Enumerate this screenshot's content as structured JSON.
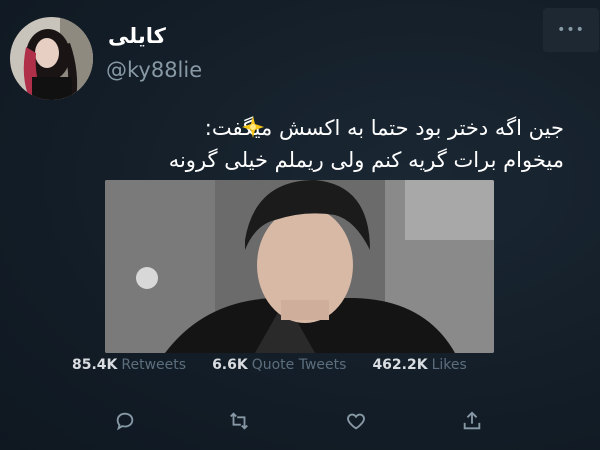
{
  "user": {
    "display_name": "کایلی",
    "handle": "@ky88lie"
  },
  "menu": {
    "more_label": "•••"
  },
  "tweet": {
    "line1": "جین اگه دختر بود حتما به اکسش میگفت:",
    "line2": "میخوام برات گریه کنم ولی ریملم خیلی گرونه",
    "emoji": "sparkle-icon"
  },
  "stats": {
    "retweets_count": "85.4K",
    "retweets_label": "Retweets",
    "quotes_count": "6.6K",
    "quotes_label": "Quote Tweets",
    "likes_count": "462.2K",
    "likes_label": "Likes"
  },
  "actions": [
    "reply-icon",
    "retweet-icon",
    "like-icon",
    "share-icon"
  ],
  "colors": {
    "background": "#15202b",
    "secondary_text": "#8899a6",
    "icon": "#8899a6"
  }
}
